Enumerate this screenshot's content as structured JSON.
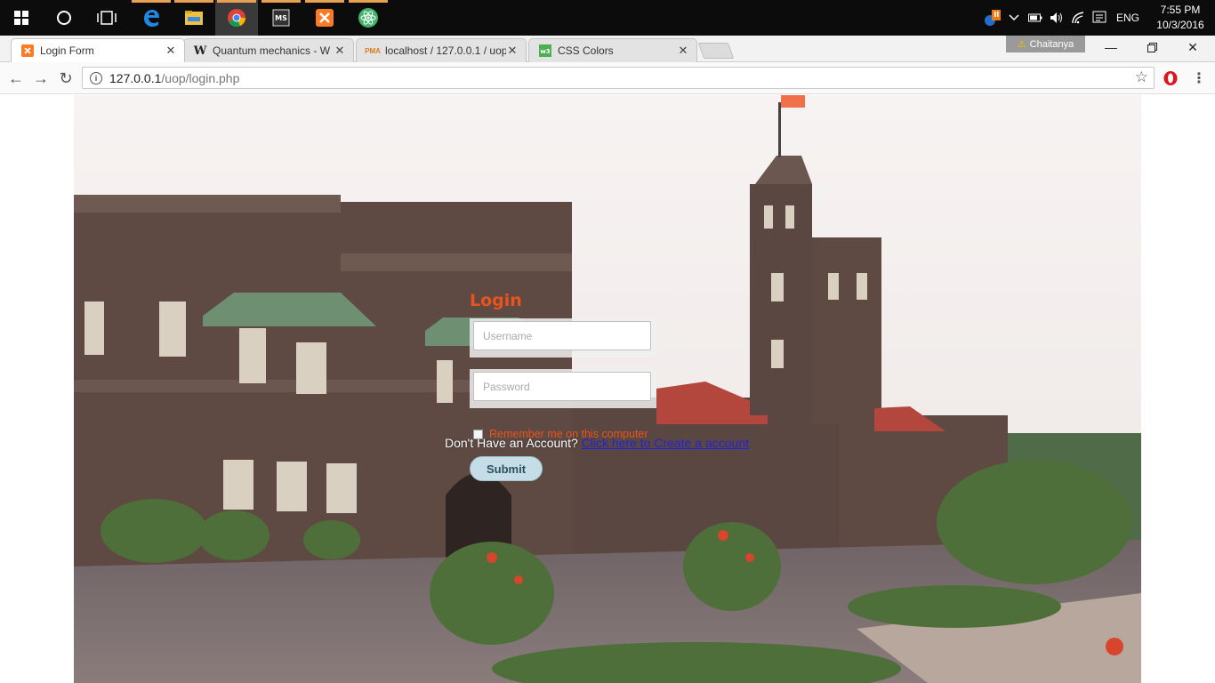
{
  "taskbar": {
    "apps": [
      {
        "name": "start-button",
        "icon": "windows-icon"
      },
      {
        "name": "cortana-button",
        "icon": "cortana-icon"
      },
      {
        "name": "task-view-button",
        "icon": "task-view-icon"
      },
      {
        "name": "edge-app",
        "icon": "edge-icon"
      },
      {
        "name": "file-explorer-app",
        "icon": "folder-icon"
      },
      {
        "name": "chrome-app",
        "icon": "chrome-icon"
      },
      {
        "name": "ms-app",
        "icon": "ms-icon"
      },
      {
        "name": "xampp-app",
        "icon": "xampp-icon"
      },
      {
        "name": "atom-app",
        "icon": "atom-icon"
      }
    ],
    "language": "ENG",
    "time": "7:55 PM",
    "date": "10/3/2016"
  },
  "browser": {
    "tabs": [
      {
        "label": "Login Form",
        "favicon": "xampp-icon",
        "active": true
      },
      {
        "label": "Quantum mechanics - W",
        "favicon": "wikipedia-icon",
        "active": false
      },
      {
        "label": "localhost / 127.0.0.1 / uop",
        "favicon": "phpmyadmin-icon",
        "active": false
      },
      {
        "label": "CSS Colors",
        "favicon": "w3schools-icon",
        "active": false
      }
    ],
    "profile_name": "Chaitanya",
    "url_host": "127.0.0.1",
    "url_path": "/uop/login.php"
  },
  "login": {
    "title": "Login",
    "username_placeholder": "Username",
    "password_placeholder": "Password",
    "remember_label": "Remember me on this computer",
    "submit_label": "Submit",
    "account_prompt": "Don't Have an Account? ",
    "account_link": "Click here to Create a account"
  },
  "colors": {
    "accent": "#e8531e",
    "submit_bg": "#c5dde6",
    "link": "#2222dd"
  }
}
